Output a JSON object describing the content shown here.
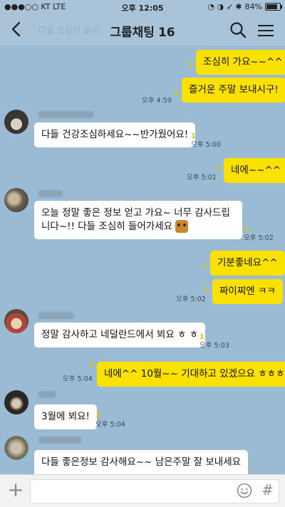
{
  "status_bar": {
    "carrier": "●●●○○ KT  LTE",
    "time": "오후 12:05",
    "icons": "◔ ◑ ➶ ✱",
    "battery_text": "84%",
    "battery_level": 0.84
  },
  "header": {
    "back_icon": "chevron-left-icon",
    "faded_text": "다들 조심히 들어",
    "title": "그룹채팅",
    "member_count": "16"
  },
  "messages": [
    {
      "side": "me",
      "unread": "1",
      "text": "조심히 가요~~^^"
    },
    {
      "side": "me",
      "unread": "1",
      "text": "즐거운 주말 보내시구!",
      "time": "오후 4:59"
    },
    {
      "side": "them",
      "unread": "1",
      "text": "다들 건강조심하세요~~반가웠어요!",
      "time": "오후 5:00"
    },
    {
      "side": "me",
      "unread": "1",
      "text": "네에~~^^",
      "time": "오후 5:01"
    },
    {
      "side": "them",
      "unread": "1",
      "text": "오늘 정말 좋은 정보 얻고 가요~ 너무 감사드립니다~!! 다들 조심히 들어가세요",
      "time": "오후 5:02"
    },
    {
      "side": "me",
      "unread": "1",
      "text": "기분좋네요^^"
    },
    {
      "side": "me",
      "unread": "1",
      "text": "짜이찌엔 ㅋㅋ",
      "time": "오후 5:02"
    },
    {
      "side": "them",
      "unread": "1",
      "text": "정말 감사하고 네덜란드에서 뵈요 ㅎ ㅎ",
      "time": "오후 5:03"
    },
    {
      "side": "me",
      "unread": "1",
      "text": "네에^^ 10월~~ 기대하고 있겠으요 ㅎㅎㅎ",
      "time": "오후 5:04"
    },
    {
      "side": "them",
      "unread": "1",
      "text": "3월에 뵈요!",
      "time": "오후 5:04"
    },
    {
      "side": "them",
      "text": "다들 좋은정보 감사해요~~ 남은주말 잘 보내세요"
    }
  ],
  "input_bar": {
    "plus_icon": "+",
    "emoji_icon": "smile-icon",
    "hash_icon": "#"
  }
}
